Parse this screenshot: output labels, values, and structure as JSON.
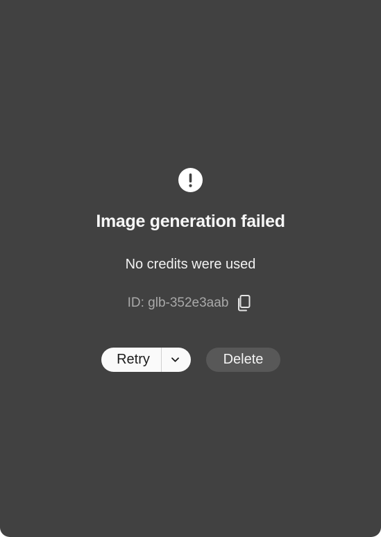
{
  "error": {
    "icon": "exclamation-circle-icon",
    "title": "Image generation failed",
    "subtitle": "No credits were used",
    "id_label": "ID: glb-352e3aab"
  },
  "actions": {
    "retry_label": "Retry",
    "retry_menu_icon": "chevron-down-icon",
    "delete_label": "Delete",
    "copy_icon": "copy-icon"
  },
  "colors": {
    "card_background": "#414141",
    "primary_button": "#fafafa",
    "secondary_button": "#585858",
    "muted_text": "#a9a9a9"
  }
}
